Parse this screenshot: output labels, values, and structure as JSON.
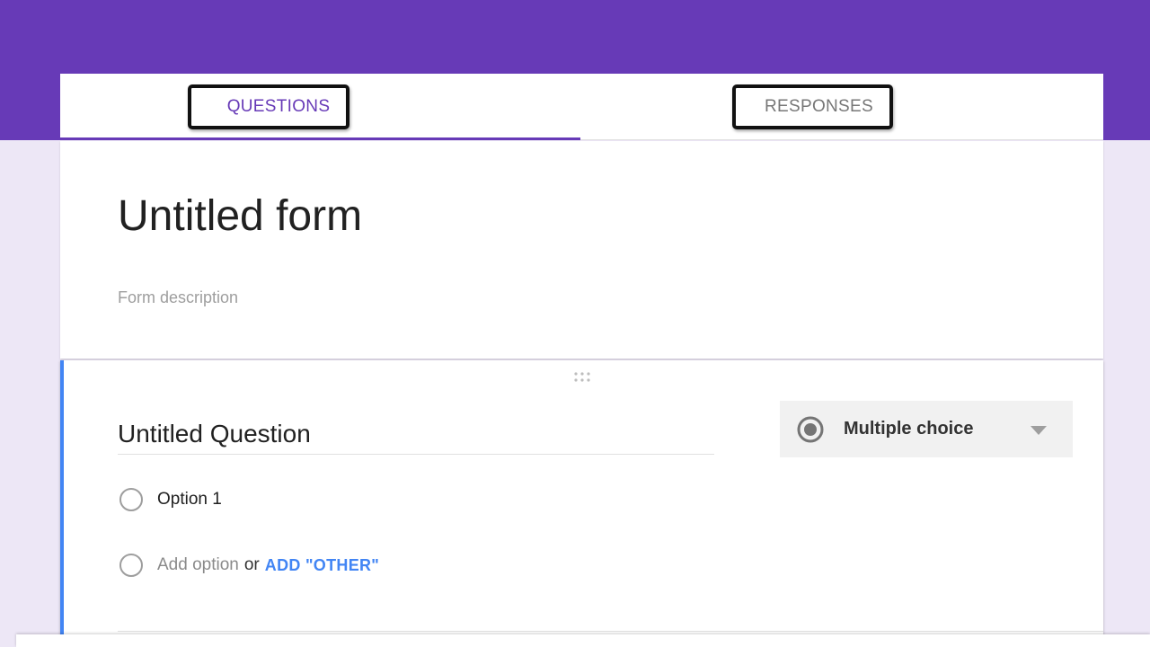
{
  "tabs": {
    "questions": "QUESTIONS",
    "responses": "RESPONSES"
  },
  "form": {
    "title": "Untitled form",
    "description_placeholder": "Form description"
  },
  "question": {
    "title": "Untitled Question",
    "type": "Multiple choice",
    "options": [
      "Option 1"
    ],
    "add_option": "Add option",
    "or": "or",
    "add_other": "ADD \"OTHER\""
  },
  "colors": {
    "theme": "#673ab7",
    "background": "#ede7f6",
    "accent": "#4285f4"
  },
  "icons": {
    "drag": "drag-handle-icon",
    "type": "radio-button-icon",
    "dropdown": "dropdown-arrow-icon"
  }
}
